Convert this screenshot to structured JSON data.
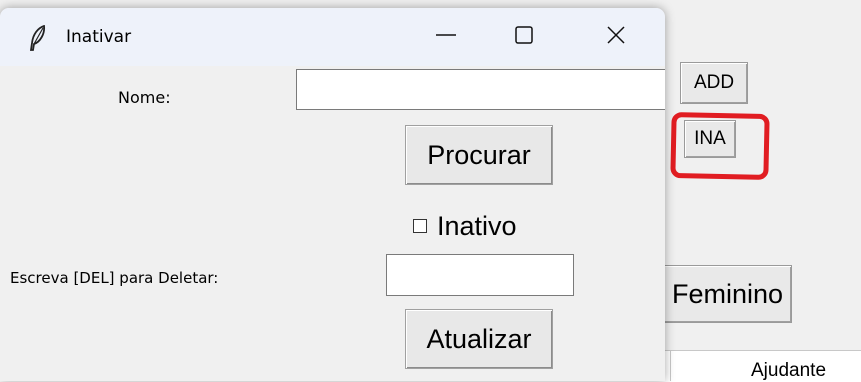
{
  "background_window": {
    "add_label": "ADD",
    "ina_label": "INA",
    "feminino_label": "Feminino",
    "ajudante_label": "Ajudante",
    "highlight_color": "#e11d22"
  },
  "dialog": {
    "title": "Inativar",
    "icon": "feather-icon",
    "controls": {
      "minimize": "minimize-icon",
      "maximize": "maximize-icon",
      "close": "close-icon"
    },
    "nome_label": "Nome:",
    "nome_value": "",
    "procurar_label": "Procurar",
    "inativo_label": "Inativo",
    "inativo_checked": false,
    "delete_label": "Escreva [DEL] para Deletar:",
    "delete_value": "",
    "atualizar_label": "Atualizar"
  }
}
